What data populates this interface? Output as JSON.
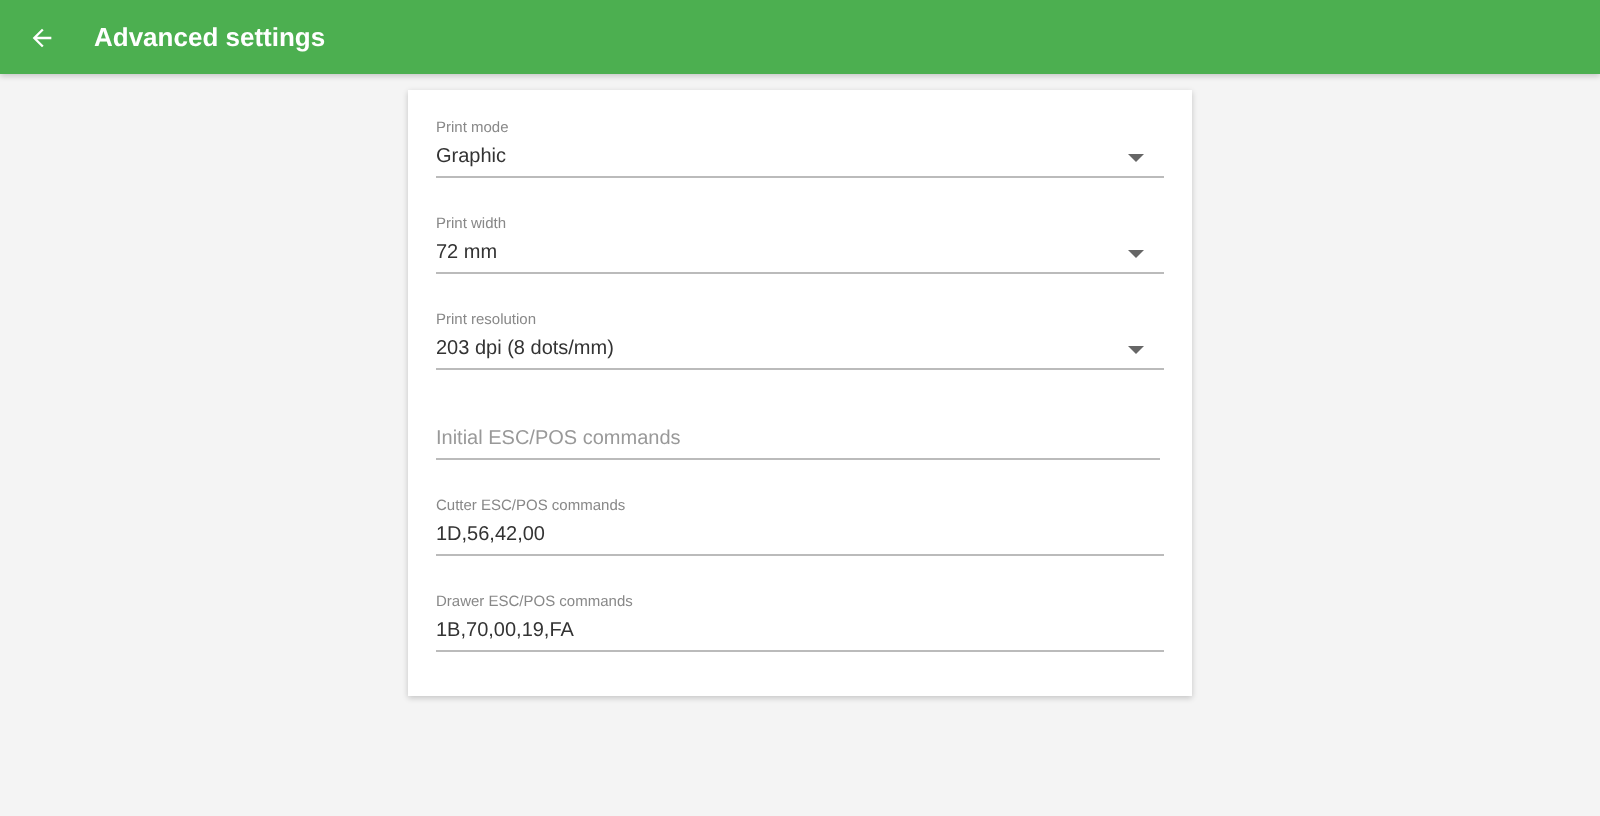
{
  "app_bar": {
    "title": "Advanced settings"
  },
  "fields": [
    {
      "kind": "select",
      "label": "Print mode",
      "value": "Graphic"
    },
    {
      "kind": "select",
      "label": "Print width",
      "value": "72 mm"
    },
    {
      "kind": "select",
      "label": "Print resolution",
      "value": "203 dpi (8 dots/mm)"
    },
    {
      "kind": "text",
      "placeholder": "Initial ESC/POS commands"
    },
    {
      "kind": "text",
      "label": "Cutter ESC/POS commands",
      "value": "1D,56,42,00"
    },
    {
      "kind": "text",
      "label": "Drawer ESC/POS commands",
      "value": "1B,70,00,19,FA"
    }
  ]
}
